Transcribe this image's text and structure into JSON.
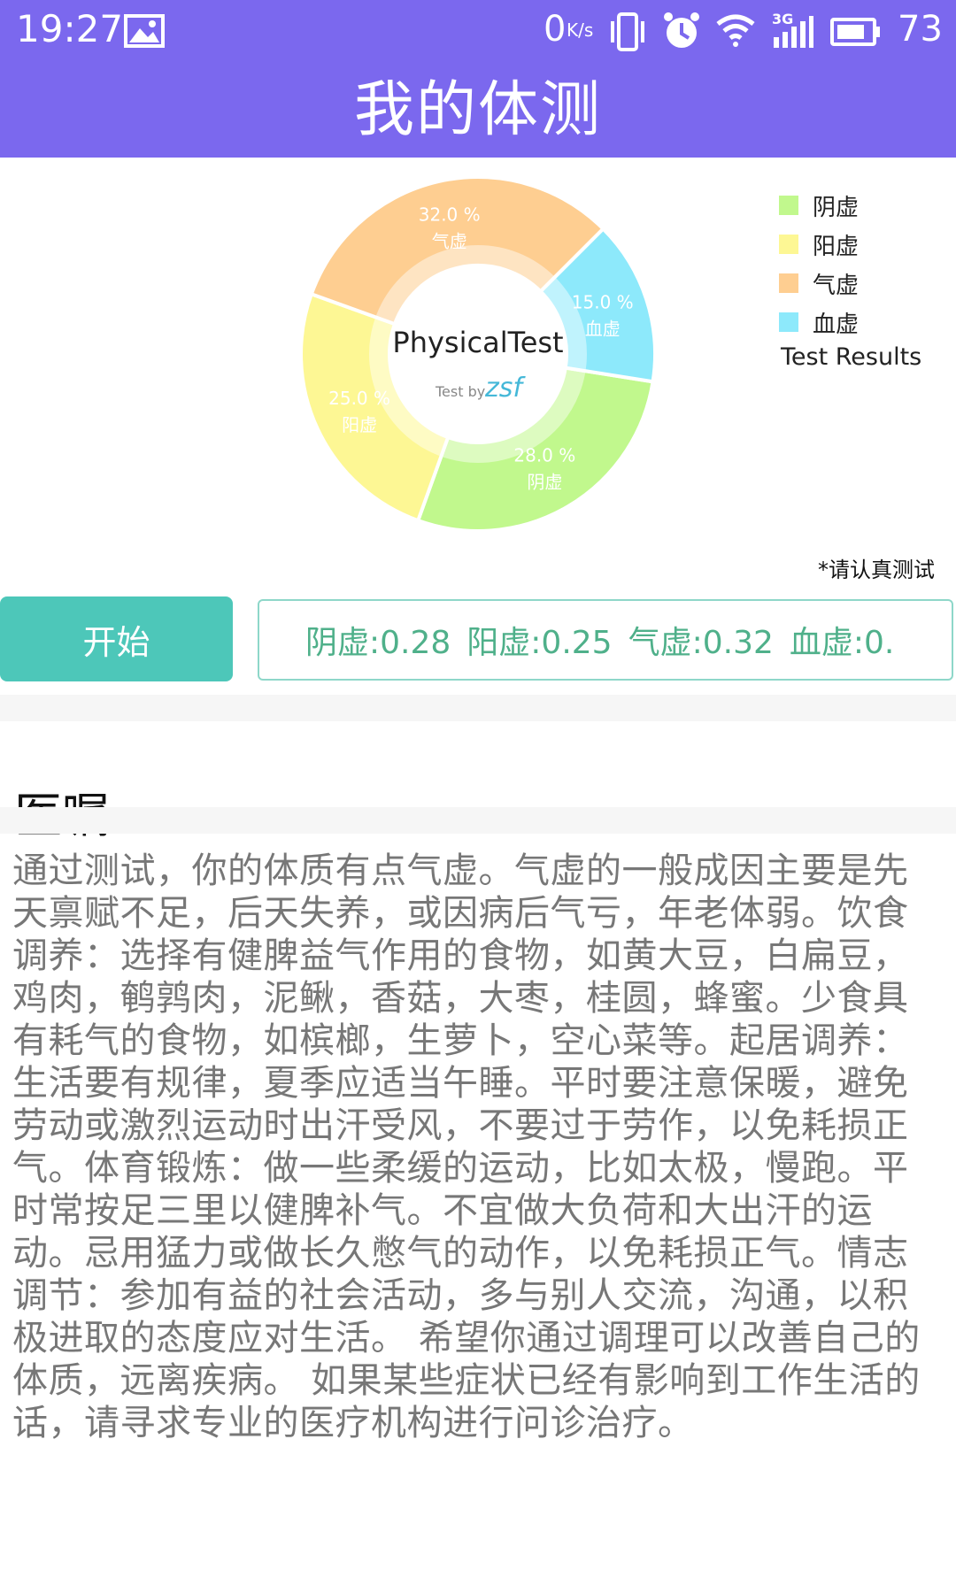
{
  "status_bar": {
    "time": "19:27",
    "net_speed": "0",
    "net_unit": "K/s",
    "network_type": "3G",
    "battery": "73",
    "icons": [
      "image-icon",
      "vibrate-icon",
      "alarm-icon",
      "wifi-icon",
      "signal-icon",
      "battery-icon"
    ]
  },
  "header": {
    "title": "我的体测"
  },
  "chart_data": {
    "type": "pie",
    "style": "donut",
    "center_text": "PhysicalTest",
    "center_subtext_prefix": "Test by",
    "center_subtext_name": "zsf",
    "legend_title": "Test Results",
    "legend_position": "top-right",
    "slices": [
      {
        "label": "阴虚",
        "value": 28.0,
        "display": "28.0 %",
        "color": "#C1F88D"
      },
      {
        "label": "阳虚",
        "value": 25.0,
        "display": "25.0 %",
        "color": "#FDF794"
      },
      {
        "label": "气虚",
        "value": 32.0,
        "display": "32.0 %",
        "color": "#FECE91"
      },
      {
        "label": "血虚",
        "value": 15.0,
        "display": "15.0 %",
        "color": "#8DE9FB"
      }
    ]
  },
  "note": "*请认真测试",
  "start_button": {
    "label": "开始"
  },
  "results": {
    "yin": "阴虚:0.28",
    "yang": "阳虚:0.25",
    "qi": "气虚:0.32",
    "blood": "血虚:0."
  },
  "advice": {
    "title": "医嘱",
    "text": "通过测试，你的体质有点气虚。气虚的一般成因主要是先天禀赋不足，后天失养，或因病后气亏，年老体弱。饮食调养：选择有健脾益气作用的食物，如黄大豆，白扁豆，鸡肉，鹌鹑肉，泥鳅，香菇，大枣，桂圆，蜂蜜。少食具有耗气的食物，如槟榔，生萝卜，空心菜等。起居调养：生活要有规律，夏季应适当午睡。平时要注意保暖，避免劳动或激烈运动时出汗受风，不要过于劳作，以免耗损正气。体育锻炼：做一些柔缓的运动，比如太极，慢跑。平时常按足三里以健脾补气。不宜做大负荷和大出汗的运动。忌用猛力或做长久憋气的动作，以免耗损正气。情志调节：参加有益的社会活动，多与别人交流，沟通，以积极进取的态度应对生活。 希望你通过调理可以改善自己的体质，远离疾病。 如果某些症状已经有影响到工作生活的话，请寻求专业的医疗机构进行问诊治疗。"
  }
}
